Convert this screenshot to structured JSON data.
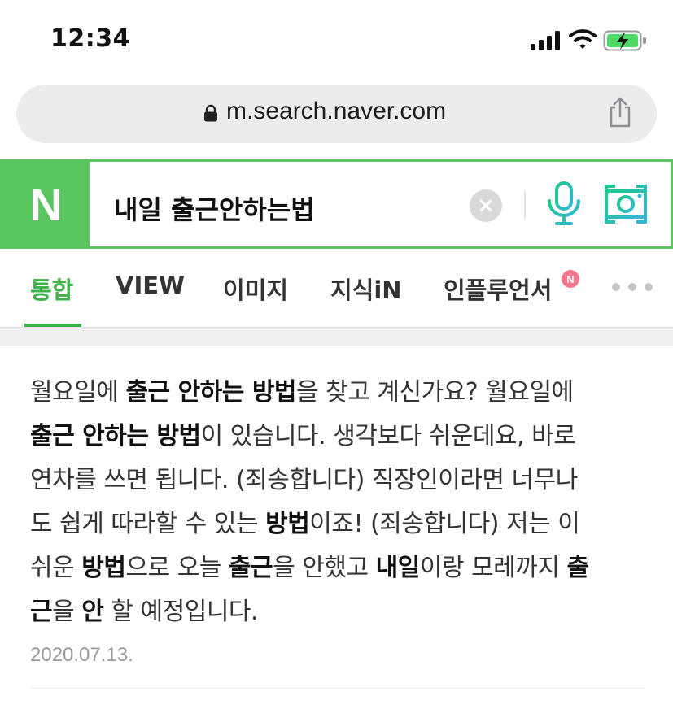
{
  "status_bar": {
    "time": "12:34"
  },
  "browser": {
    "url": "m.search.naver.com"
  },
  "search": {
    "logo_text": "N",
    "query": "내일 출근안하는법",
    "clear_symbol": "×"
  },
  "tabs": {
    "items": [
      {
        "label": "통합"
      },
      {
        "label": "VIEW"
      },
      {
        "label": "이미지"
      },
      {
        "label": "지식iN"
      },
      {
        "label": "인플루언서"
      }
    ],
    "badge": "N"
  },
  "colors": {
    "naver_green": "#58c55f",
    "active_tab": "#3fb24a",
    "badge": "#f7778a"
  },
  "result": {
    "lines": [
      [
        {
          "t": "월요일에 "
        },
        {
          "t": "출근 안하는 방법",
          "b": true
        },
        {
          "t": "을 찾고 계신가요? 월요일에"
        }
      ],
      [
        {
          "t": "출근 안하는 방법",
          "b": true
        },
        {
          "t": "이 있습니다. 생각보다 쉬운데요, 바로"
        }
      ],
      [
        {
          "t": "연차를 쓰면 됩니다. (죄송합니다) 직장인이라면 너무나"
        }
      ],
      [
        {
          "t": "도 쉽게 따라할 수 있는 "
        },
        {
          "t": "방법",
          "b": true
        },
        {
          "t": "이죠! (죄송합니다) 저는 이"
        }
      ],
      [
        {
          "t": "쉬운 "
        },
        {
          "t": "방법",
          "b": true
        },
        {
          "t": "으로 오늘 "
        },
        {
          "t": "출근",
          "b": true
        },
        {
          "t": "을 안했고 "
        },
        {
          "t": "내일",
          "b": true
        },
        {
          "t": "이랑 모레까지 "
        },
        {
          "t": "출",
          "b": true
        }
      ],
      [
        {
          "t": "근",
          "b": true
        },
        {
          "t": "을 "
        },
        {
          "t": "안",
          "b": true
        },
        {
          "t": " 할 예정입니다."
        }
      ]
    ],
    "date": "2020.07.13."
  }
}
